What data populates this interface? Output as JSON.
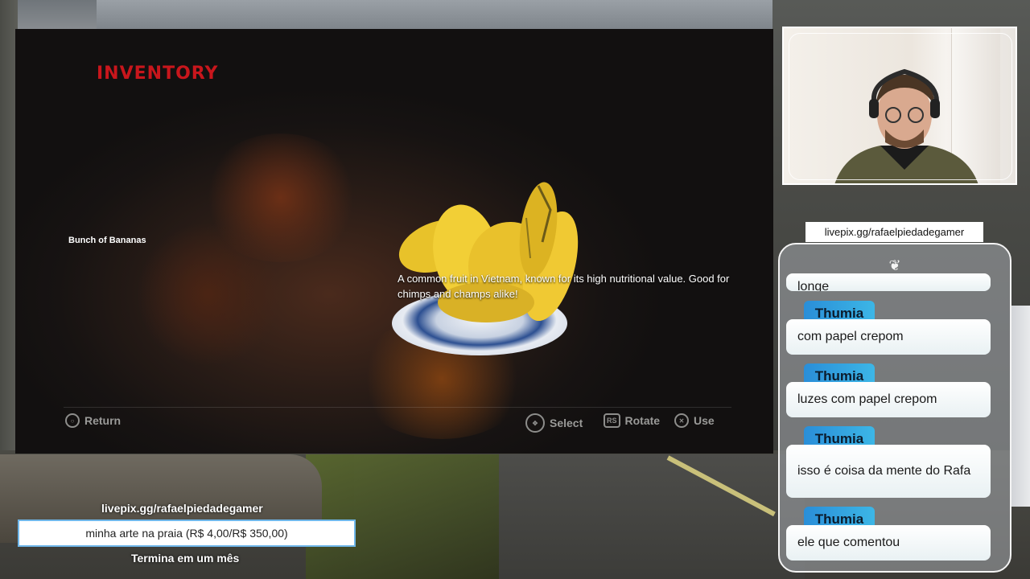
{
  "game": {
    "section_title": "INVENTORY",
    "item_name": "Bunch of Bananas",
    "item_description": "A common fruit in Vietnam, known for its high nutritional value. Good for chimps and champs alike!",
    "controls": {
      "return": "Return",
      "select": "Select",
      "rotate": "Rotate",
      "rotate_key": "RS",
      "use": "Use"
    }
  },
  "chat": {
    "url": "livepix.gg/rafaelpiedadegamer",
    "messages": [
      {
        "user": "",
        "text": "longe"
      },
      {
        "user": "Thumia",
        "text": "com papel crepom"
      },
      {
        "user": "Thumia",
        "text": "luzes com papel crepom"
      },
      {
        "user": "Thumia",
        "text": "isso é coisa da mente do Rafa"
      },
      {
        "user": "Thumia",
        "text": "ele que comentou"
      }
    ]
  },
  "donation": {
    "url": "livepix.gg/rafaelpiedadegamer",
    "goal_text": "minha arte na praia (R$ 4,00/R$ 350,00)",
    "subtitle": "Termina em um mês"
  },
  "colors": {
    "inventory_title": "#c8161c",
    "chat_user_badge": "#2a8ed8",
    "donation_border": "#6fb7ea"
  }
}
